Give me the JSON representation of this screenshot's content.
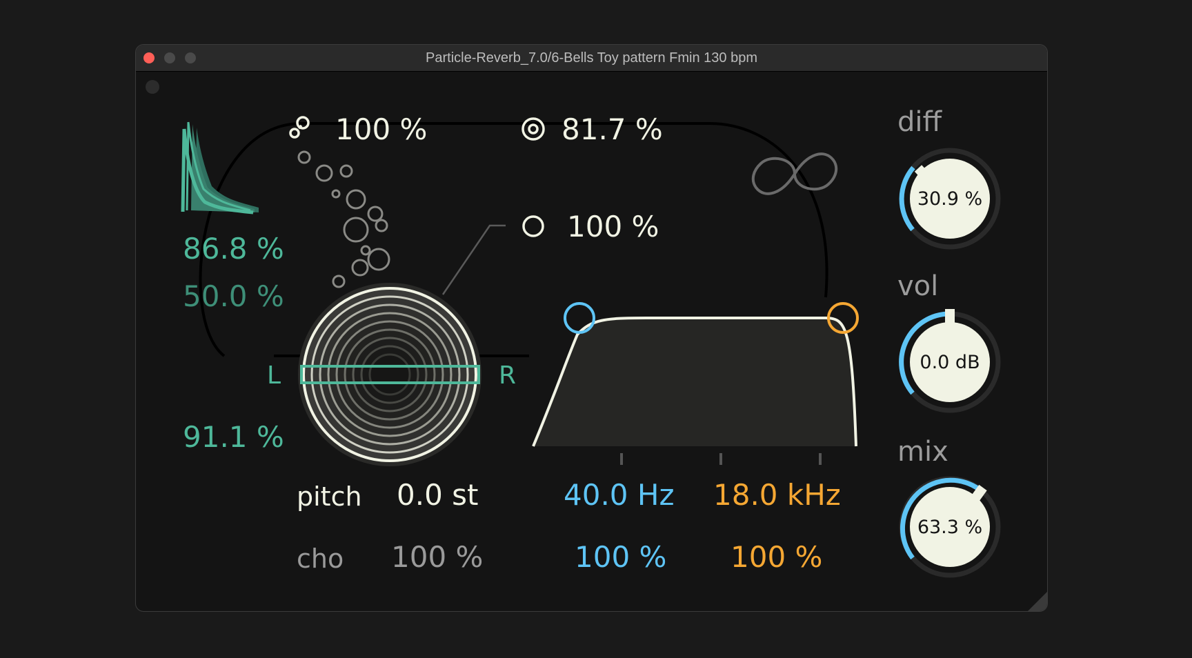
{
  "window": {
    "title": "Particle-Reverb_7.0/6-Bells Toy pattern Fmin 130 bpm"
  },
  "left_panel": {
    "decay_value": "86.8 %",
    "decay_secondary": "50.0 %",
    "width_value": "91.1 %",
    "pan_left_label": "L",
    "pan_right_label": "R"
  },
  "particles": {
    "density_value": "100 %",
    "focus_value": "81.7 %",
    "size_value": "100 %"
  },
  "pitch": {
    "label": "pitch",
    "value": "0.0 st"
  },
  "chorus": {
    "label": "cho",
    "value": "100 %"
  },
  "filter": {
    "low_freq": "40.0 Hz",
    "high_freq": "18.0 kHz",
    "low_amount": "100 %",
    "high_amount": "100 %"
  },
  "knobs": {
    "diff": {
      "label": "diff",
      "value": "30.9 %",
      "level": 0.309
    },
    "vol": {
      "label": "vol",
      "value": "0.0 dB"
    },
    "mix": {
      "label": "mix",
      "value": "63.3 %",
      "level": 0.633
    }
  },
  "colors": {
    "teal": "#4eb89a",
    "blue": "#5ec4f5",
    "orange": "#f5a733",
    "cream": "#f1f3e4",
    "background": "#141414"
  },
  "icons": [
    "decay-envelope-icon",
    "density-icon",
    "focus-icon",
    "size-icon",
    "infinity-icon",
    "particles-icon"
  ]
}
